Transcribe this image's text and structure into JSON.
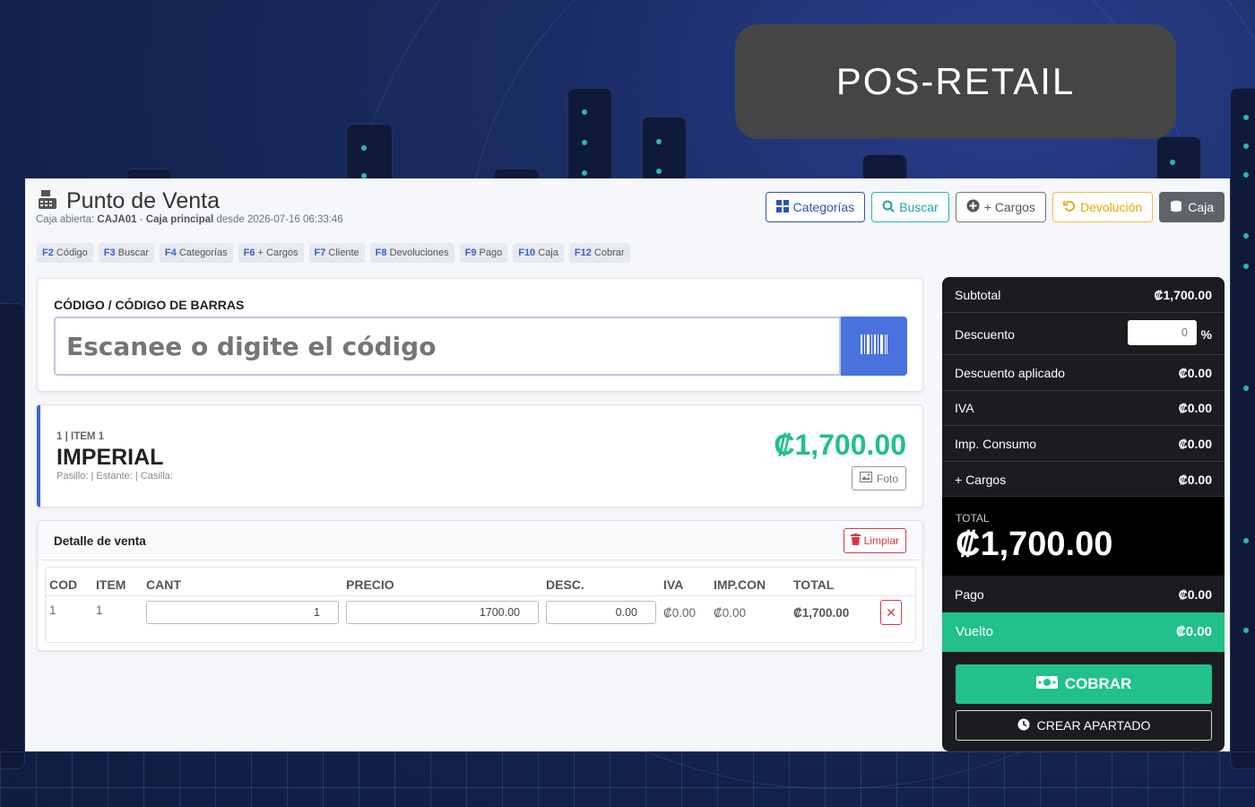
{
  "brand": {
    "logo_text": "POS-RETAIL"
  },
  "header": {
    "title": "Punto de Venta",
    "caja_prefix": "Caja abierta:",
    "caja_code": "CAJA01",
    "caja_sep": " - ",
    "caja_name": "Caja principal",
    "since_label": "desde",
    "since_value": "2026-07-16 06:33:46"
  },
  "toolbar": {
    "categorias": "Categorías",
    "buscar": "Buscar",
    "cargos": "+ Cargos",
    "devolucion": "Devolución",
    "caja": "Caja"
  },
  "shortcuts": [
    {
      "key": "F2",
      "label": "Código"
    },
    {
      "key": "F3",
      "label": "Buscar"
    },
    {
      "key": "F4",
      "label": "Categorías"
    },
    {
      "key": "F6",
      "label": "+ Cargos"
    },
    {
      "key": "F7",
      "label": "Cliente"
    },
    {
      "key": "F8",
      "label": "Devoluciones"
    },
    {
      "key": "F9",
      "label": "Pago"
    },
    {
      "key": "F10",
      "label": "Caja"
    },
    {
      "key": "F12",
      "label": "Cobrar"
    }
  ],
  "scanner": {
    "label": "CÓDIGO / CÓDIGO DE BARRAS",
    "placeholder": "Escanee o digite el código",
    "value": ""
  },
  "product": {
    "code_line": "1 | ITEM 1",
    "name": "IMPERIAL",
    "location": "Pasillo: | Estante: | Casilla:",
    "price": "₡1,700.00",
    "foto_label": "Foto"
  },
  "detail": {
    "title": "Detalle de venta",
    "clear_label": "Limpiar",
    "columns": [
      "COD",
      "ITEM",
      "CANT",
      "PRECIO",
      "DESC.",
      "IVA",
      "IMP.CON",
      "TOTAL"
    ],
    "rows": [
      {
        "cod": "1",
        "item": "1",
        "cant": "1",
        "precio": "1700.00",
        "desc": "0.00",
        "iva": "₡0.00",
        "impcon": "₡0.00",
        "total": "₡1,700.00"
      }
    ]
  },
  "summary": {
    "subtotal_label": "Subtotal",
    "subtotal": "₡1,700.00",
    "descuento_label": "Descuento",
    "descuento_value": "0",
    "descuento_unit": "%",
    "desc_aplicado_label": "Descuento aplicado",
    "desc_aplicado": "₡0.00",
    "iva_label": "IVA",
    "iva": "₡0.00",
    "imp_label": "Imp. Consumo",
    "imp": "₡0.00",
    "cargos_label": "+ Cargos",
    "cargos": "₡0.00",
    "total_label": "TOTAL",
    "total": "₡1,700.00",
    "pago_label": "Pago",
    "pago": "₡0.00",
    "vuelto_label": "Vuelto",
    "vuelto": "₡0.00",
    "cobrar_label": "COBRAR",
    "apartado_label": "CREAR APARTADO"
  },
  "colors": {
    "accent": "#3f64d2",
    "success": "#22c08a",
    "danger": "#dc3545",
    "panel": "#1b1c1f"
  }
}
